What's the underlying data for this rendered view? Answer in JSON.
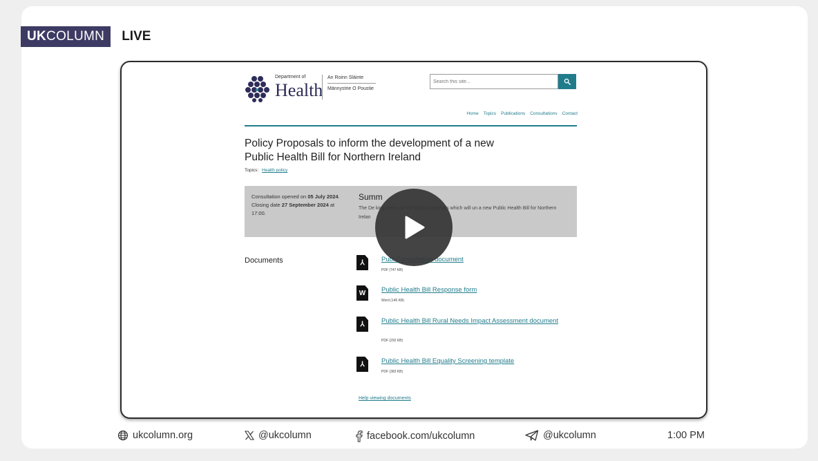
{
  "brand": {
    "name_bold": "UK",
    "name_rest": "COLUMN",
    "live": "LIVE"
  },
  "page": {
    "dept_of": "Department of",
    "health": "Health",
    "irish_1": "An Roinn Sláinte",
    "irish_2": "Männystrie O Poustie",
    "search_placeholder": "Search this site...",
    "nav": [
      "Home",
      "Topics",
      "Publications",
      "Consultations",
      "Contact"
    ],
    "title": "Policy Proposals to inform the development of a new Public Health Bill for Northern Ireland",
    "topics_label": "Topics:",
    "topics_link": "Health policy",
    "consult_1": "Consultation opened on ",
    "consult_date1": "05 July 2024",
    "consult_2": ". Closing date ",
    "consult_date2": "27 September 2024",
    "consult_3": " at 17:00.",
    "summary_heading": "Summ",
    "summary_text": "The De                          king views on the policy proposals which will un                          a new Public Health Bill for Northern Irelan",
    "documents_label": "Documents",
    "documents": [
      {
        "icon": "pdf-icon",
        "glyph": "⅄",
        "title": "Publ                   Consultation document",
        "meta": "PDF (747 KB)"
      },
      {
        "icon": "word-icon",
        "glyph": "W",
        "title": "Public Health Bill Response form",
        "meta": "Word (145 KB)"
      },
      {
        "icon": "pdf-icon",
        "glyph": "⅄",
        "title": "Public Health Bill Rural Needs Impact Assessment document",
        "meta": "PDF (292 KB)"
      },
      {
        "icon": "pdf-icon",
        "glyph": "⅄",
        "title": "Public Health Bill Equality Screening template",
        "meta": "PDF (383 KB)"
      }
    ],
    "help": "Help viewing documents"
  },
  "footer": {
    "website": "ukcolumn.org",
    "x": "@ukcolumn",
    "facebook": "facebook.com/ukcolumn",
    "telegram": "@ukcolumn",
    "time": "1:00 PM"
  },
  "colors": {
    "accent": "#207c8b",
    "brand": "#3d3b63",
    "play": "#343434"
  }
}
